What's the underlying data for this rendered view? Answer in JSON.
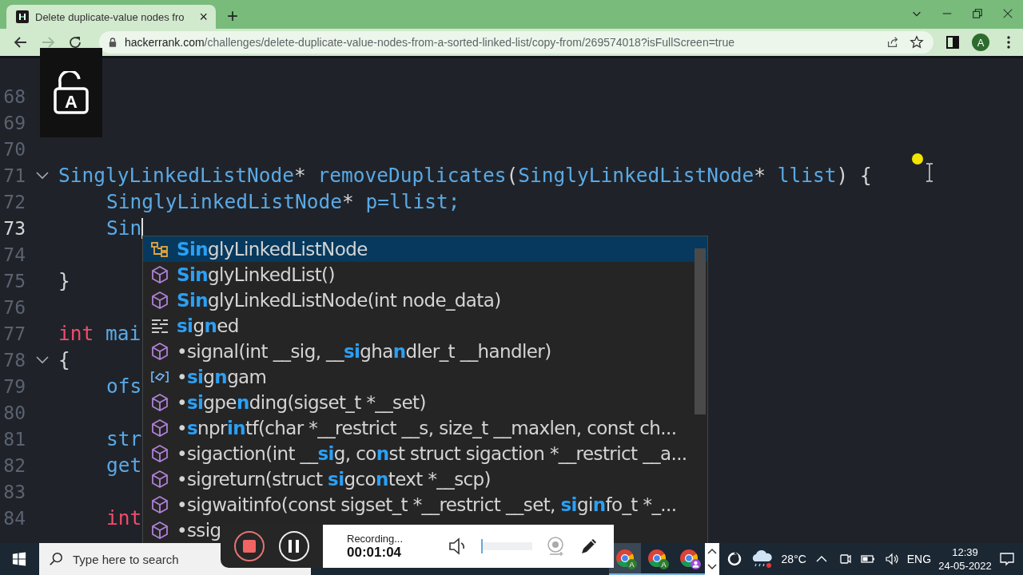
{
  "browser": {
    "tab": {
      "title": "Delete duplicate-value nodes fro",
      "close": "×"
    },
    "new_tab": "+",
    "url": {
      "domain": "hackerrank.com",
      "path": "/challenges/delete-duplicate-value-nodes-from-a-sorted-linked-list/copy-from/269574018?isFullScreen=true"
    },
    "forward_disabled": true,
    "avatar": "A"
  },
  "lock_overlay": {
    "letter": "A"
  },
  "editor": {
    "lines": [
      {
        "number": "68",
        "active": false,
        "foldable": false
      },
      {
        "number": "69",
        "active": false,
        "foldable": false
      },
      {
        "number": "70",
        "active": false,
        "foldable": false
      },
      {
        "number": "71",
        "active": false,
        "foldable": true,
        "indented": false,
        "tokens": [
          {
            "text": "SinglyLinkedListNode",
            "kind": "ident"
          },
          {
            "text": "* ",
            "kind": "punct"
          },
          {
            "text": "removeDuplicates",
            "kind": "ident"
          },
          {
            "text": "(",
            "kind": "punct"
          },
          {
            "text": "SinglyLinkedListNode",
            "kind": "ident"
          },
          {
            "text": "* ",
            "kind": "punct"
          },
          {
            "text": "llist",
            "kind": "ident"
          },
          {
            "text": ") {",
            "kind": "punct"
          }
        ]
      },
      {
        "number": "72",
        "active": false,
        "foldable": false,
        "indented": true,
        "tokens": [
          {
            "text": "SinglyLinkedListNode",
            "kind": "ident"
          },
          {
            "text": "* ",
            "kind": "punct"
          },
          {
            "text": "p=llist;",
            "kind": "ident"
          }
        ]
      },
      {
        "number": "73",
        "active": true,
        "foldable": false,
        "indented": true,
        "tokens": [
          {
            "text": "Sin",
            "kind": "ident"
          }
        ]
      },
      {
        "number": "74",
        "active": false,
        "foldable": false
      },
      {
        "number": "75",
        "active": false,
        "foldable": false,
        "indented": false,
        "tokens": [
          {
            "text": "}",
            "kind": "punct"
          }
        ]
      },
      {
        "number": "76",
        "active": false,
        "foldable": false
      },
      {
        "number": "77",
        "active": false,
        "foldable": false,
        "indented": false,
        "tokens": [
          {
            "text": "int",
            "kind": "keyword"
          },
          {
            "text": " mai",
            "kind": "ident"
          }
        ]
      },
      {
        "number": "78",
        "active": false,
        "foldable": true,
        "indented": false,
        "tokens": [
          {
            "text": "{",
            "kind": "punct"
          }
        ]
      },
      {
        "number": "79",
        "active": false,
        "foldable": false,
        "indented": true,
        "tokens": [
          {
            "text": "ofs",
            "kind": "ident"
          }
        ]
      },
      {
        "number": "80",
        "active": false,
        "foldable": false
      },
      {
        "number": "81",
        "active": false,
        "foldable": false,
        "indented": true,
        "tokens": [
          {
            "text": "str",
            "kind": "ident"
          }
        ]
      },
      {
        "number": "82",
        "active": false,
        "foldable": false,
        "indented": true,
        "tokens": [
          {
            "text": "get",
            "kind": "ident"
          }
        ]
      },
      {
        "number": "83",
        "active": false,
        "foldable": false
      },
      {
        "number": "84",
        "active": false,
        "foldable": false,
        "indented": true,
        "tokens": [
          {
            "text": "int",
            "kind": "keyword"
          }
        ]
      }
    ]
  },
  "suggestions": [
    {
      "kind": "class",
      "selected": true,
      "parts": [
        {
          "text": "Sin",
          "match": true
        },
        {
          "text": "glyLinkedListNode",
          "match": false
        }
      ]
    },
    {
      "kind": "method",
      "selected": false,
      "parts": [
        {
          "text": "Sin",
          "match": true
        },
        {
          "text": "glyLinkedList()",
          "match": false
        }
      ]
    },
    {
      "kind": "method",
      "selected": false,
      "parts": [
        {
          "text": "Sin",
          "match": true
        },
        {
          "text": "glyLinkedListNode(int node_data)",
          "match": false
        }
      ]
    },
    {
      "kind": "keyword",
      "selected": false,
      "parts": [
        {
          "text": "si",
          "match": true
        },
        {
          "text": "g",
          "match": false
        },
        {
          "text": "n",
          "match": true
        },
        {
          "text": "ed",
          "match": false
        }
      ]
    },
    {
      "kind": "method",
      "selected": false,
      "parts": [
        {
          "text": "•signal(int __sig, __",
          "match": false
        },
        {
          "text": "si",
          "match": true
        },
        {
          "text": "gha",
          "match": false
        },
        {
          "text": "n",
          "match": true
        },
        {
          "text": "dler_t __handler)",
          "match": false
        }
      ]
    },
    {
      "kind": "variable",
      "selected": false,
      "parts": [
        {
          "text": "•",
          "match": false
        },
        {
          "text": "si",
          "match": true
        },
        {
          "text": "g",
          "match": false
        },
        {
          "text": "n",
          "match": true
        },
        {
          "text": "gam",
          "match": false
        }
      ]
    },
    {
      "kind": "method",
      "selected": false,
      "parts": [
        {
          "text": "•",
          "match": false
        },
        {
          "text": "si",
          "match": true
        },
        {
          "text": "gpe",
          "match": false
        },
        {
          "text": "n",
          "match": true
        },
        {
          "text": "ding(sigset_t *__set)",
          "match": false
        }
      ]
    },
    {
      "kind": "method",
      "selected": false,
      "parts": [
        {
          "text": "•",
          "match": false
        },
        {
          "text": "s",
          "match": true
        },
        {
          "text": "npr",
          "match": false
        },
        {
          "text": "in",
          "match": true
        },
        {
          "text": "tf(char *__restrict __s, size_t __maxlen, const ch...",
          "match": false
        }
      ]
    },
    {
      "kind": "method",
      "selected": false,
      "parts": [
        {
          "text": "•sigaction(int __",
          "match": false
        },
        {
          "text": "si",
          "match": true
        },
        {
          "text": "g, co",
          "match": false
        },
        {
          "text": "n",
          "match": true
        },
        {
          "text": "st struct sigaction *__restrict __a...",
          "match": false
        }
      ]
    },
    {
      "kind": "method",
      "selected": false,
      "parts": [
        {
          "text": "•sigreturn(struct ",
          "match": false
        },
        {
          "text": "si",
          "match": true
        },
        {
          "text": "gco",
          "match": false
        },
        {
          "text": "n",
          "match": true
        },
        {
          "text": "text *__scp)",
          "match": false
        }
      ]
    },
    {
      "kind": "method",
      "selected": false,
      "parts": [
        {
          "text": "•sigwaitinfo(const sigset_t *__restrict __set, ",
          "match": false
        },
        {
          "text": "si",
          "match": true
        },
        {
          "text": "gi",
          "match": false
        },
        {
          "text": "n",
          "match": true
        },
        {
          "text": "fo_t *_...",
          "match": false
        }
      ]
    },
    {
      "kind": "method",
      "selected": false,
      "parts": [
        {
          "text": "•ssig",
          "match": false
        }
      ]
    }
  ],
  "recorder": {
    "status": "Recording...",
    "time": "00:01:04",
    "volume": {
      "level": 0
    }
  },
  "taskbar": {
    "search": {
      "placeholder": "Type here to search"
    },
    "apps": [
      {
        "badge": "A",
        "active": true
      },
      {
        "badge": "A",
        "active": false
      },
      {
        "active": false
      }
    ],
    "weather": "28°C",
    "language": "ENG",
    "time": "12:39",
    "date": "24-05-2022"
  }
}
